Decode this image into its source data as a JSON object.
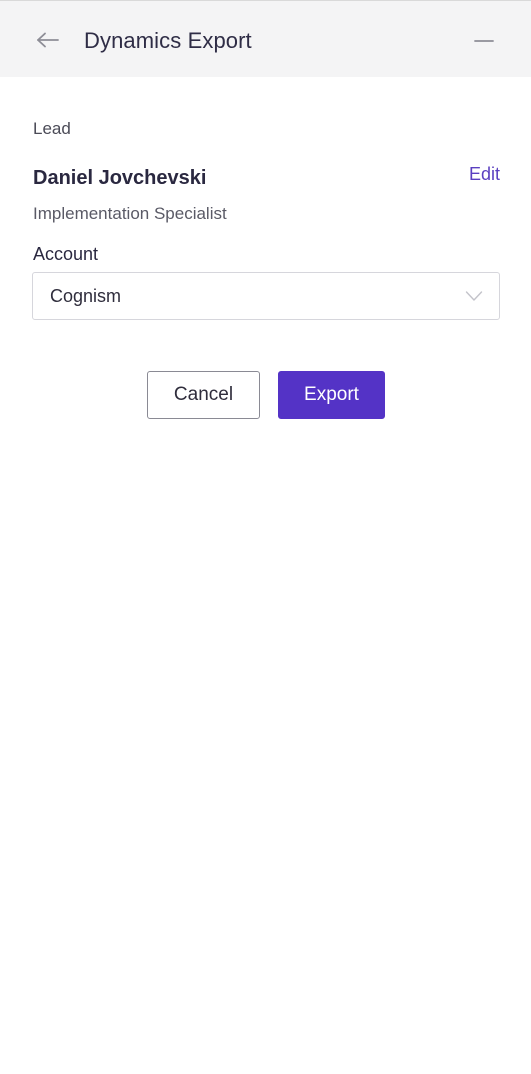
{
  "header": {
    "title": "Dynamics Export"
  },
  "lead": {
    "section_label": "Lead",
    "name": "Daniel Jovchevski",
    "edit_label": "Edit",
    "job_title": "Implementation Specialist"
  },
  "account": {
    "label": "Account",
    "selected_value": "Cognism"
  },
  "actions": {
    "cancel_label": "Cancel",
    "export_label": "Export"
  },
  "icons": {
    "back": "arrow-left-icon",
    "minimize": "minus-icon",
    "dropdown": "chevron-down-icon"
  },
  "colors": {
    "accent": "#5433c6",
    "edit_link": "#5a3fc0",
    "header_bg": "#f4f4f5"
  }
}
